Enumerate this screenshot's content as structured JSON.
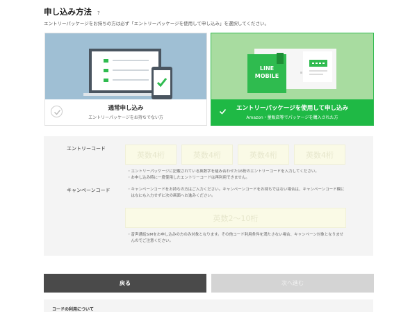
{
  "header": {
    "title": "申し込み方法",
    "help_label": "?",
    "subtitle": "エントリーパッケージをお持ちの方は必ず「エントリーパッケージを使用して申し込み」を選択してください。"
  },
  "options": [
    {
      "title": "通常申し込み",
      "subtitle": "エントリーパッケージをお持ちでない方",
      "selected": false
    },
    {
      "title": "エントリーパッケージを使用して申し込み",
      "subtitle": "Amazon・量販店等でパッケージを購入された方",
      "selected": true,
      "package_text": [
        "LINE",
        "MOBILE"
      ]
    }
  ],
  "entry_code": {
    "label": "エントリーコード",
    "placeholders": [
      "英数4桁",
      "英数4桁",
      "英数4桁",
      "英数4桁"
    ],
    "notes": [
      "・エントリーパッケージに記載されている英数字を組み合わせた16桁のエントリーコードを入力してください。",
      "・お申し込み時に一度使用したエントリーコードは再利用できません。"
    ]
  },
  "campaign_code": {
    "label": "キャンペーンコード",
    "notes": [
      "・キャンペーンコードをお持ちの方はご入力ください。キャンペーンコードをお持ちではない場合は、キャンペーンコード欄に",
      "　はなにも入力せずに次の画面へお進みください。"
    ],
    "placeholder": "英数2〜10桁",
    "notes_after": [
      "・音声通話SIMをお申し込みの方のみ対象となります。その他コード利用条件を満たさない場合、キャンペーン対象となりませ",
      "　んのでご注意ください。"
    ]
  },
  "buttons": {
    "back": "戻る",
    "next": "次へ進む"
  },
  "footer": {
    "label": "コードの利用について"
  },
  "colors": {
    "accent": "#1fb945",
    "selected_bg": "#a8dca0",
    "unselected_bg": "#9fbfd4",
    "back_button": "#4a4a4a",
    "next_button_disabled": "#d4d4d4"
  }
}
